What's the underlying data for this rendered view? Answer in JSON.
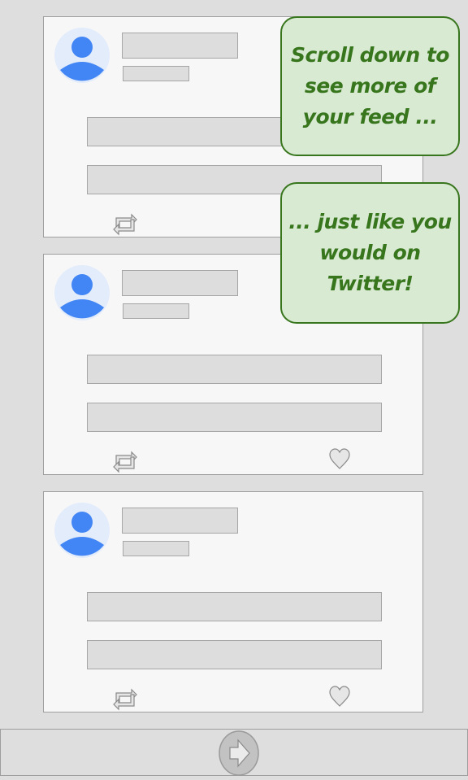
{
  "feed": {
    "posts": [
      {
        "id": "post-1",
        "has_like_icon": false
      },
      {
        "id": "post-2",
        "has_like_icon": true
      },
      {
        "id": "post-3",
        "has_like_icon": true
      }
    ]
  },
  "callouts": {
    "first": "Scroll down to see more of your feed ...",
    "second": "... just like you would on Twitter!"
  },
  "colors": {
    "callout_bg": "#d9ead3",
    "callout_border": "#38761d",
    "callout_text": "#38761d",
    "avatar_blue": "#4285f4",
    "avatar_bg": "#e3ecfb"
  },
  "icons": {
    "avatar": "user-avatar-icon",
    "retweet": "retweet-icon",
    "like": "heart-icon",
    "next": "arrow-right-icon"
  }
}
